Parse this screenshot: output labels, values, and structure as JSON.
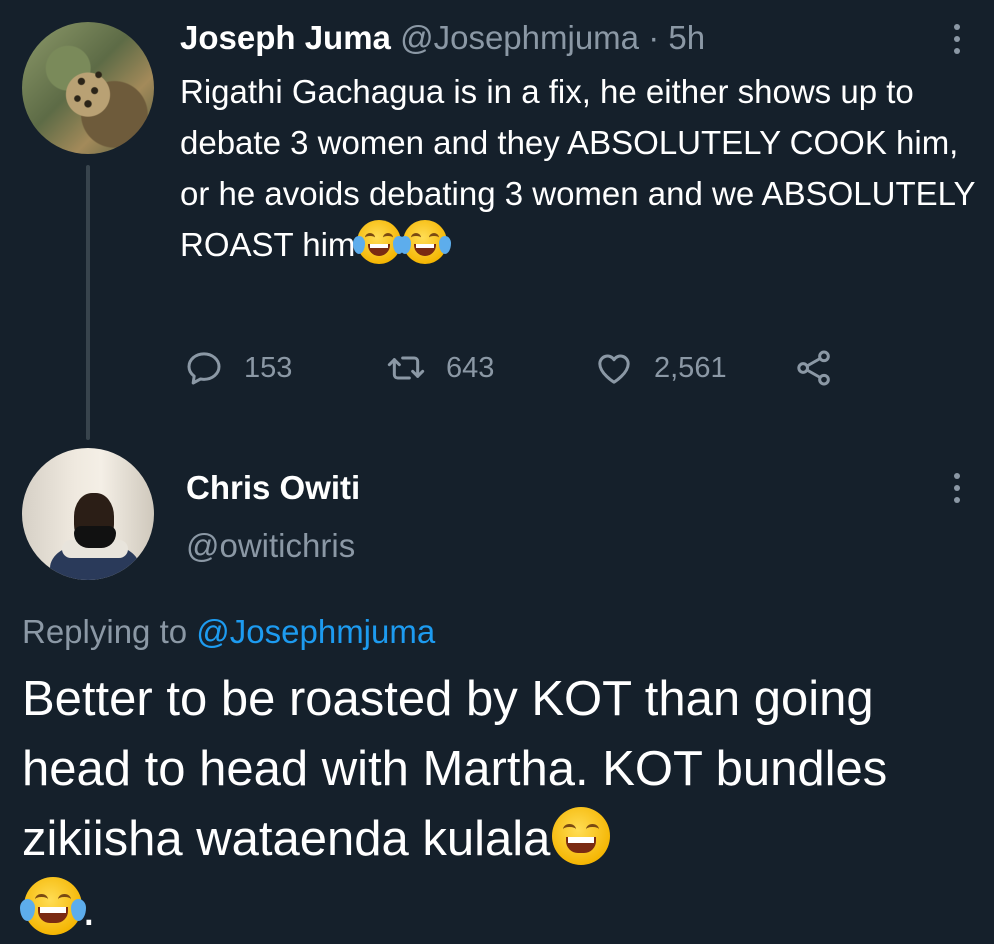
{
  "original_tweet": {
    "display_name": "Joseph Juma",
    "handle": "@Josephmjuma",
    "separator": "·",
    "time": "5h",
    "text": "Rigathi Gachagua is in a fix, he either shows up to debate 3 women and they ABSOLUTELY COOK him, or he avoids debating 3 women and we ABSOLUTELY ROAST him",
    "emojis": [
      "face-with-tears-of-joy",
      "face-with-tears-of-joy"
    ],
    "stats": {
      "replies": "153",
      "retweets": "643",
      "likes": "2,561"
    },
    "avatar_icon": "leopard-avatar"
  },
  "reply_tweet": {
    "display_name": "Chris Owiti",
    "handle": "@owitichris",
    "replying_to_prefix": "Replying to",
    "replying_to_handle": "@Josephmjuma",
    "text_part1": "Better to be roasted by KOT than going head to head with Martha. KOT bundles zikiisha wataenda kulala",
    "text_part2": ".",
    "emojis": [
      "grinning-face-with-smiling-eyes",
      "face-with-tears-of-joy"
    ],
    "avatar_icon": "user-photo-avatar"
  },
  "icons": {
    "reply": "reply-icon",
    "retweet": "retweet-icon",
    "like": "heart-icon",
    "share": "share-icon",
    "more": "more-options-icon"
  },
  "colors": {
    "background": "#15202b",
    "text_primary": "#ffffff",
    "text_secondary": "#8b98a5",
    "link": "#1d9bf0",
    "thread_line": "#38444d"
  }
}
